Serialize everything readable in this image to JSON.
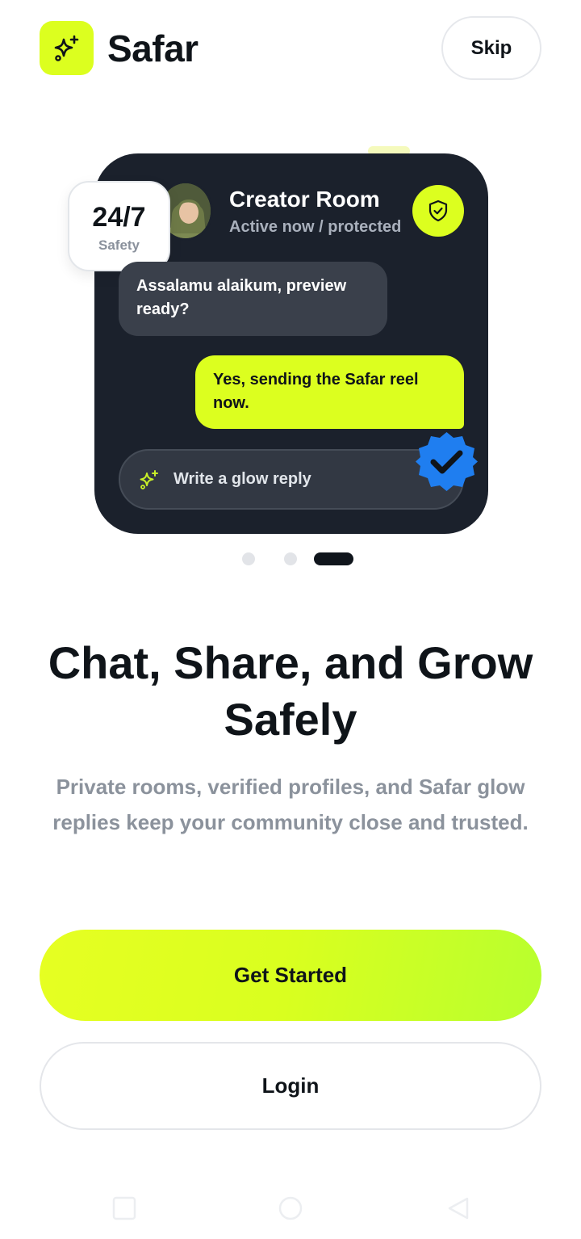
{
  "header": {
    "brand": "Safar",
    "skip_label": "Skip",
    "logo_icon": "sparkle-icon"
  },
  "preview_card": {
    "room_title": "Creator Room",
    "room_status": "Active now / protected",
    "safety_value": "24/7",
    "safety_label": "Safety",
    "incoming_message": "Assalamu alaikum, preview ready?",
    "outgoing_message": "Yes, sending the Safar reel now.",
    "reply_placeholder": "Write a glow reply",
    "icons": [
      "shield-check-icon",
      "sparkle-icon",
      "verified-badge-icon"
    ]
  },
  "pager": {
    "count": 3,
    "active_index": 2
  },
  "onboarding": {
    "headline": "Chat, Share, and Grow Safely",
    "description": "Private rooms, verified profiles, and Safar glow replies keep your community close and trusted."
  },
  "actions": {
    "primary_label": "Get Started",
    "secondary_label": "Login"
  },
  "colors": {
    "accent": "#dcff1f",
    "card_bg": "#1b212c",
    "verified_blue": "#1f7ef0",
    "text_dark": "#0f1419",
    "text_muted": "#8b929c"
  },
  "system_nav": [
    "recents-icon",
    "home-icon",
    "back-icon"
  ]
}
